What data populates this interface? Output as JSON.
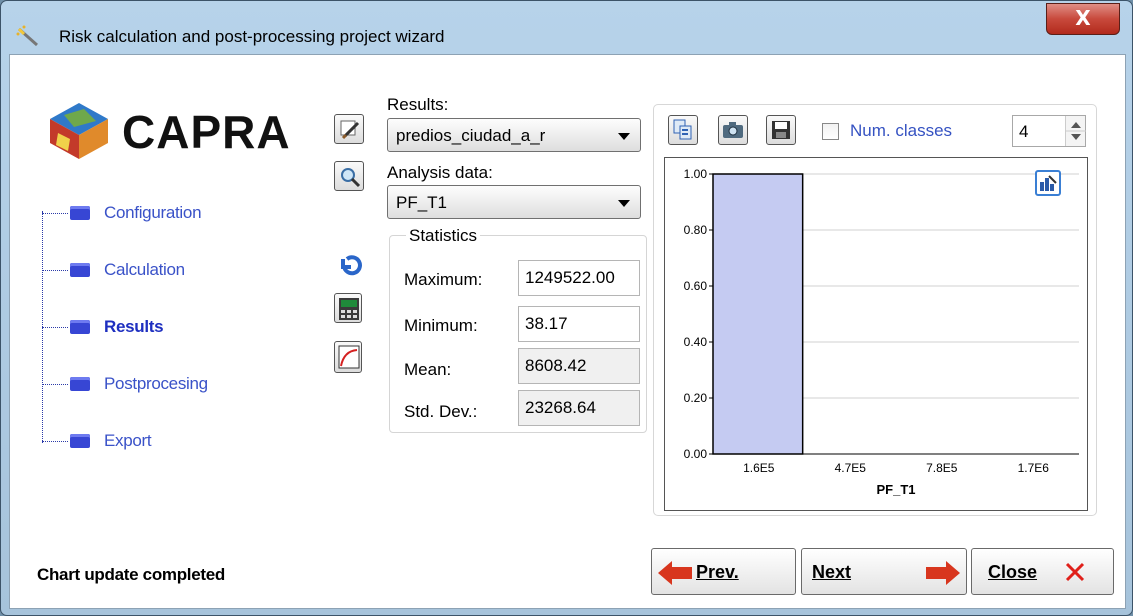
{
  "window": {
    "title": "Risk calculation and post-processing project wizard",
    "close_glyph": "X",
    "icon": "wand-icon"
  },
  "logo": {
    "text": "CAPRA"
  },
  "nav": {
    "items": [
      {
        "label": "Configuration",
        "active": false
      },
      {
        "label": "Calculation",
        "active": false
      },
      {
        "label": "Results",
        "active": true
      },
      {
        "label": "Postprocesing",
        "active": false
      },
      {
        "label": "Export",
        "active": false
      }
    ]
  },
  "results": {
    "label": "Results:",
    "selected": "predios_ciudad_a_r"
  },
  "analysis": {
    "label": "Analysis data:",
    "selected": "PF_T1"
  },
  "statistics": {
    "title": "Statistics",
    "maximum_label": "Maximum:",
    "maximum": "1249522.00",
    "minimum_label": "Minimum:",
    "minimum": "38.17",
    "mean_label": "Mean:",
    "mean": "8608.42",
    "stddev_label": "Std. Dev.:",
    "stddev": "23268.64"
  },
  "chart_toolbar": {
    "num_classes_label": "Num. classes",
    "num_classes_checked": false,
    "num_classes_value": "4"
  },
  "chart_data": {
    "type": "bar",
    "categories": [
      "1.6E5",
      "4.7E5",
      "7.8E5",
      "1.7E6"
    ],
    "values": [
      1.0,
      0.0,
      0.0,
      0.0
    ],
    "xlabel": "PF_T1",
    "ylabel": "",
    "ylim": [
      0,
      1.0
    ],
    "yticks": [
      "0.00",
      "0.20",
      "0.40",
      "0.60",
      "0.80",
      "1.00"
    ],
    "grid": true,
    "bar_color": "#c5cbf2"
  },
  "status": {
    "text": "Chart update completed"
  },
  "buttons": {
    "prev": "Prev.",
    "next": "Next",
    "close": "Close"
  }
}
